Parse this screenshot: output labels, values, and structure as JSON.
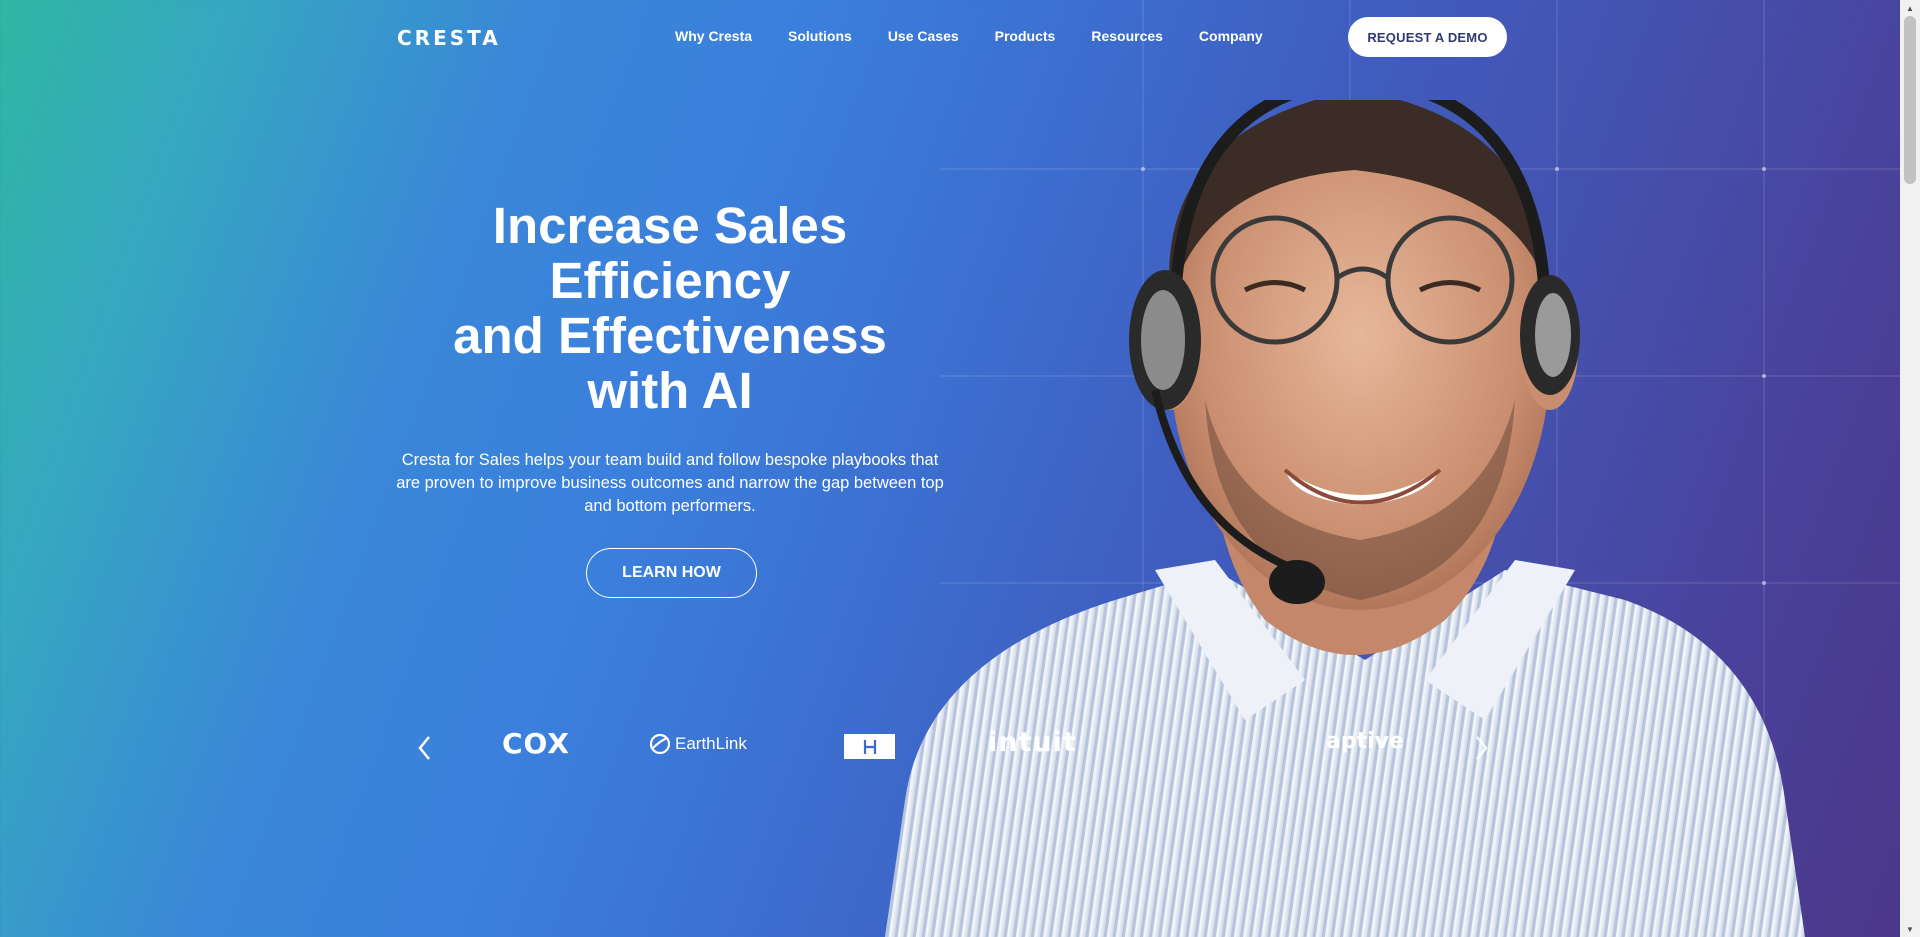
{
  "header": {
    "logo": "CRESTA",
    "nav": [
      {
        "label": "Why Cresta"
      },
      {
        "label": "Solutions"
      },
      {
        "label": "Use Cases"
      },
      {
        "label": "Products"
      },
      {
        "label": "Resources"
      },
      {
        "label": "Company"
      }
    ],
    "demo_button": "REQUEST A DEMO"
  },
  "hero": {
    "title_lines": [
      "Increase Sales",
      "Efficiency",
      "and Effectiveness",
      "with AI"
    ],
    "description": "Cresta for Sales helps your team build and follow bespoke playbooks that are proven to improve business outcomes and narrow the gap between top and bottom performers.",
    "cta": "LEARN HOW"
  },
  "carousel": {
    "logos": [
      "COX",
      "EarthLink",
      "intuit",
      "aptive"
    ]
  },
  "colors": {
    "gradient_start": "#2fb6a2",
    "gradient_mid": "#3b7fdc",
    "gradient_end": "#4b3788",
    "demo_button_text": "#2e3a73"
  }
}
